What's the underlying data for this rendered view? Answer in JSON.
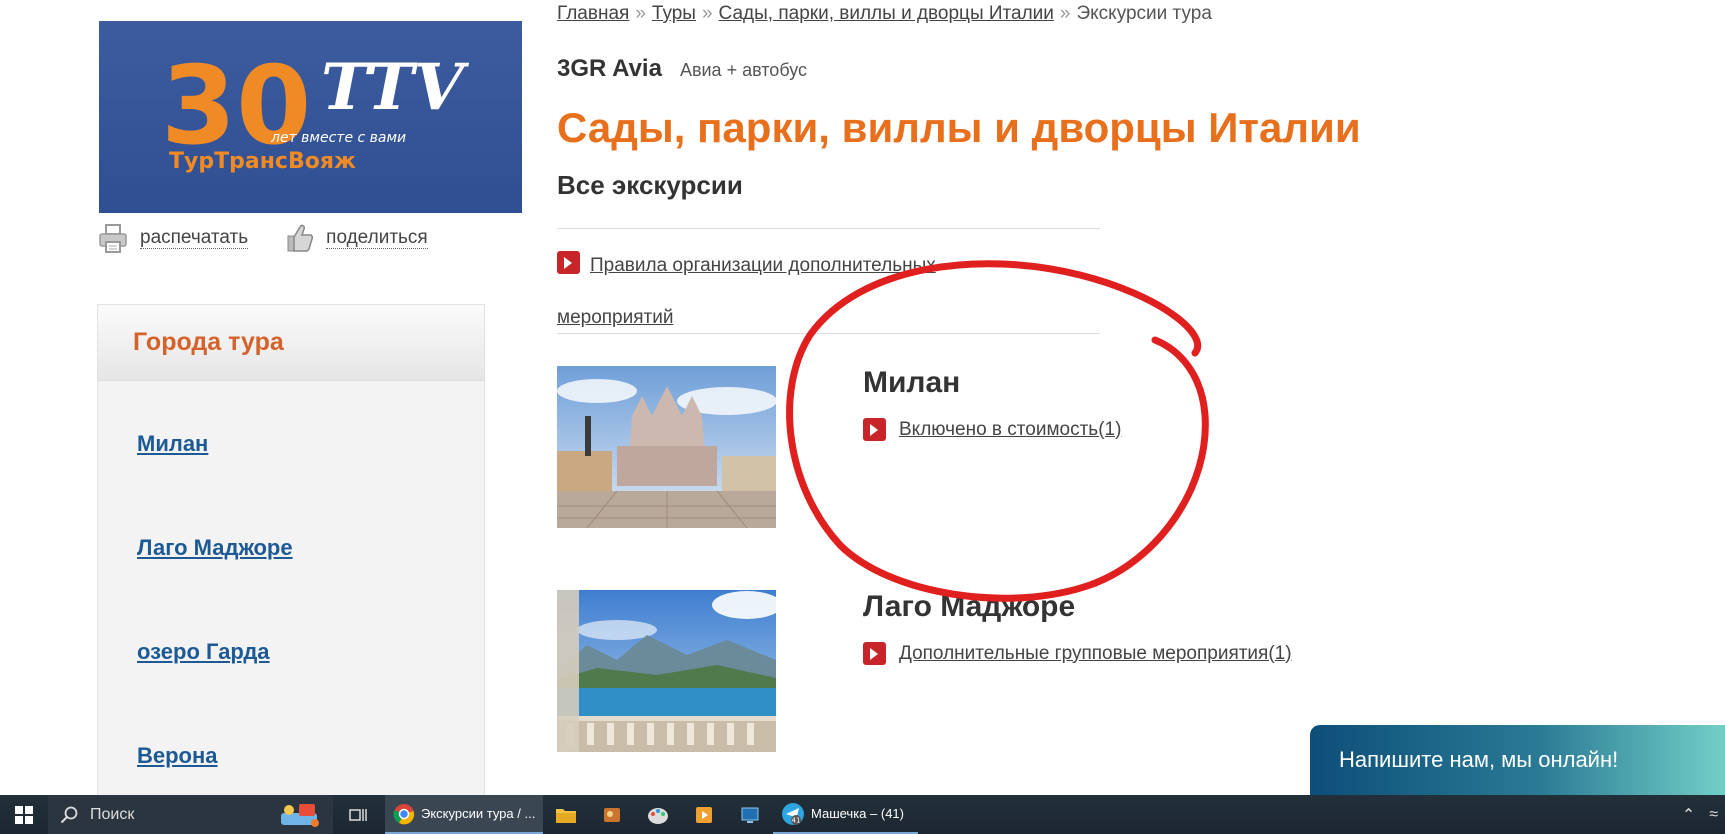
{
  "logo": {
    "number": "30",
    "mark": "TTV",
    "tagline": "лет вместе с вами",
    "name": "ТурТрансВояж"
  },
  "actions": {
    "print": "распечатать",
    "share": "поделиться"
  },
  "sidebar": {
    "title": "Города тура",
    "cities": [
      "Милан",
      "Лаго Маджоре",
      "озеро Гарда",
      "Верона"
    ]
  },
  "breadcrumb": {
    "items": [
      "Главная",
      "Туры",
      "Сады, парки, виллы и дворцы Италии"
    ],
    "current": "Экскурсии тура",
    "separator": "»"
  },
  "operator": {
    "brand": "3GR Avia",
    "type": "Авиа + автобус"
  },
  "page": {
    "title": "Сады, парки, виллы и дворцы Италии",
    "subtitle": "Все экскурсии",
    "rules_link": "Правила организации дополнительных мероприятий"
  },
  "cities": [
    {
      "name": "Милан",
      "link": "Включено в стоимость(1)"
    },
    {
      "name": "Лаго Маджоре",
      "link": "Дополнительные групповые мероприятия(1)"
    }
  ],
  "chat": {
    "label": "Напишите нам, мы онлайн!"
  },
  "taskbar": {
    "search_label": "Поиск",
    "browser_tab": "Экскурсии тура / ...",
    "telegram": "Машечка – (41)",
    "telegram_badge": "41"
  },
  "colors": {
    "accent_orange": "#e8701d",
    "link_blue": "#1d5a95",
    "logo_bg": "#3b5998",
    "annotation_red": "#e01f1f"
  }
}
